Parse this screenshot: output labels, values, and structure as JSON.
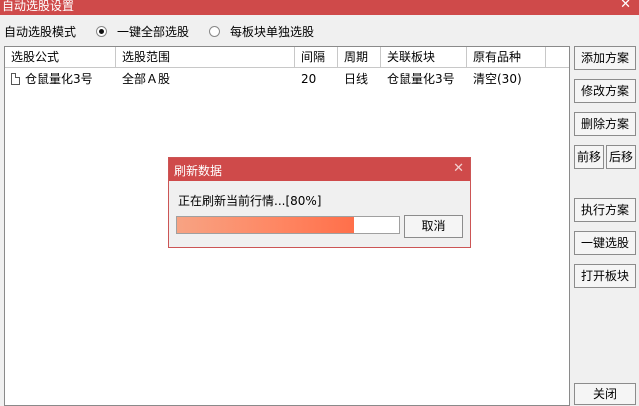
{
  "window": {
    "title": "自动选股设置",
    "close": "✕"
  },
  "mode": {
    "label": "自动选股模式",
    "options": [
      {
        "label": "一键全部选股",
        "checked": true
      },
      {
        "label": "每板块单独选股",
        "checked": false
      }
    ]
  },
  "table": {
    "columns": [
      "选股公式",
      "选股范围",
      "间隔",
      "周期",
      "关联板块",
      "原有品种"
    ],
    "rows": [
      [
        "仓鼠量化3号",
        "全部Ａ股",
        "20",
        "日线",
        "仓鼠量化3号",
        "清空(30)"
      ]
    ]
  },
  "buttons": {
    "add": "添加方案",
    "edit": "修改方案",
    "delete": "删除方案",
    "move_up": "前移",
    "move_down": "后移",
    "run": "执行方案",
    "one_click": "一键选股",
    "open_block": "打开板块",
    "close": "关闭"
  },
  "dialog": {
    "title": "刷新数据",
    "close": "✕",
    "message": "正在刷新当前行情...[80%]",
    "progress": 0.8,
    "cancel": "取消"
  }
}
